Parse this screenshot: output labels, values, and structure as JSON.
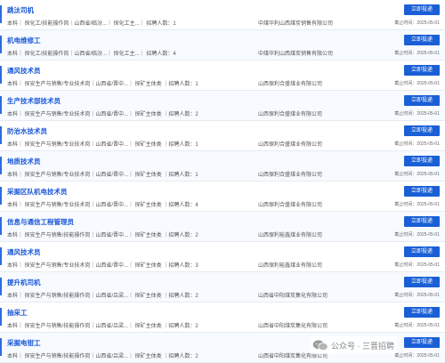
{
  "jobs": [
    {
      "title": "跳汰司机",
      "details": "本科｜ 探化工/技能操作岗｜山西省/临汾...｜ 探化工主...｜ 招聘人数：1",
      "company": "中煤华利山西煤炭销售有限公司",
      "button": "立即投递",
      "deadline": "截止时间：2025-05-01"
    },
    {
      "title": "机电维修工",
      "details": "本科｜ 探化工/技能操作岗｜山西省/临汾...｜ 探化工主...｜ 招聘人数：4",
      "company": "中煤华利山西煤炭销售有限公司",
      "button": "立即投递",
      "deadline": "截止时间：2025-05-01"
    },
    {
      "title": "通风技术员",
      "details": "本科｜ 探安生产与销售/专业技术岗｜山西省/晋中...｜ 探矿主体类 ｜招聘人数：1",
      "company": "山西保利合盛煤业有限公司",
      "button": "立即投递",
      "deadline": "截止时间：2025-05-01"
    },
    {
      "title": "生产技术部技术员",
      "details": "本科｜ 探安生产与销售/专业技术岗｜山西省/晋中...｜ 探矿主体类 ｜招聘人数：2",
      "company": "山西保利合盛煤业有限公司",
      "button": "立即投递",
      "deadline": "截止时间：2025-05-01"
    },
    {
      "title": "防治水技术员",
      "details": "本科｜ 探安生产与销售/专业技术岗｜山西省/晋中...｜ 探矿主体类 ｜招聘人数：1",
      "company": "山西保利合盛煤业有限公司",
      "button": "立即投递",
      "deadline": "截止时间：2025-05-01"
    },
    {
      "title": "地质技术员",
      "details": "本科｜ 探安生产与销售/专业技术岗｜山西省/晋中...｜ 探矿主体类 ｜招聘人数：1",
      "company": "山西保利合盛煤业有限公司",
      "button": "立即投递",
      "deadline": "截止时间：2025-05-01"
    },
    {
      "title": "采掘区队机电技术员",
      "details": "本科｜ 探安生产与销售/专业技术岗｜山西省/晋中...｜ 探矿主体类 ｜招聘人数：4",
      "company": "山西保利合盛煤业有限公司",
      "button": "立即投递",
      "deadline": "截止时间：2025-05-01"
    },
    {
      "title": "信息与通信工程管理员",
      "details": "本科｜ 探安生产与销售/技能操作岗｜山西省/晋中...｜ 探矿主体类 ｜招聘人数：2",
      "company": "山西保利裕鑫煤业有限公司",
      "button": "立即投递",
      "deadline": "截止时间：2025-05-01"
    },
    {
      "title": "通风技术员",
      "details": "本科｜ 探安生产与销售/专业技术岗｜山西省/晋中...｜ 探矿主体类 ｜招聘人数：3",
      "company": "山西保利裕鑫煤业有限公司",
      "button": "立即投递",
      "deadline": "截止时间：2025-05-01"
    },
    {
      "title": "提升机司机",
      "details": "本科｜ 探安生产与销售/技能操作岗｜山西省/吕梁...｜ 探矿主体类 ｜招聘人数：2",
      "company": "山西省中阳煤炭集化有限公司",
      "button": "立即投递",
      "deadline": "截止时间：2025-05-01"
    },
    {
      "title": "抽采工",
      "details": "本科｜ 探安生产与销售/技能操作岗｜山西省/吕梁...｜ 探矿主体类 ｜招聘人数：2",
      "company": "山西省中阳煤炭集化有限公司",
      "button": "立即投递",
      "deadline": "截止时间：2025-05-01"
    },
    {
      "title": "采掘电钳工",
      "details": "本科｜ 探安生产与销售/技能操作岗｜山西省/吕梁...｜ 探矿主体类 ｜招聘人数：2",
      "company": "山西省中阳煤炭集化有限公司",
      "button": "立即投递",
      "deadline": "截止时间：2025-05-01"
    }
  ],
  "watermark": {
    "text": "公众号 · 三晋招聘",
    "icon": "wechat-official-account-icon"
  }
}
